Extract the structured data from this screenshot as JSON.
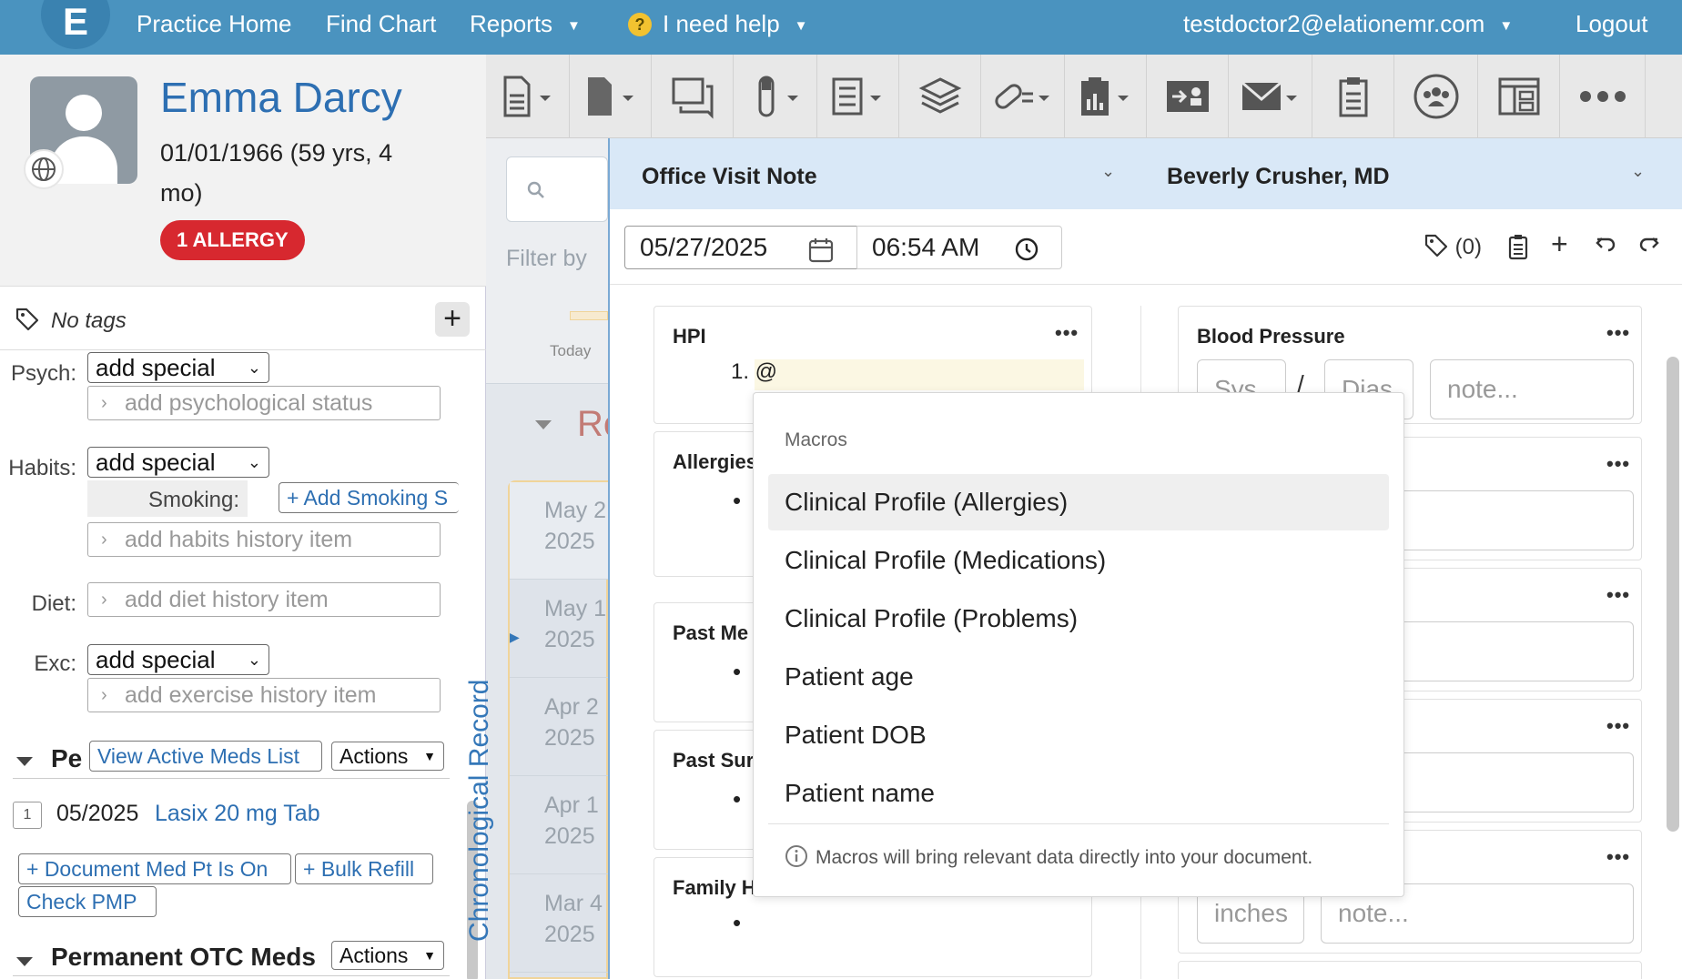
{
  "topnav": {
    "logo_glyph": "E",
    "practice_home": "Practice Home",
    "find_chart": "Find Chart",
    "reports": "Reports",
    "help_badge": "?",
    "help": "I need help",
    "user_email": "testdoctor2@elationemr.com",
    "logout": "Logout"
  },
  "patient": {
    "name": "Emma Darcy",
    "dob": "01/01/1966 (59 yrs, 4 mo)",
    "allergy_badge": "1 ALLERGY"
  },
  "tags": {
    "label": "No tags",
    "add": "+"
  },
  "history": {
    "psych_label": "Psych:",
    "psych_select": "add special",
    "psych_field": "add psychological status",
    "habits_label": "Habits:",
    "habits_select": "add special",
    "smoking_label": "Smoking:",
    "smoking_button": "+ Add Smoking S",
    "habits_field": "add habits history item",
    "diet_label": "Diet:",
    "diet_field": "add diet history item",
    "exc_label": "Exc:",
    "exc_select": "add special",
    "exc_field": "add exercise history item"
  },
  "meds": {
    "section_title": "Pe",
    "view_active": "View Active Meds List",
    "actions": "Actions",
    "row_qty": "1",
    "row_date": "05/2025",
    "row_med": "Lasix 20 mg Tab",
    "document_med": "+ Document Med Pt Is On",
    "bulk_refill": "+ Bulk Refill",
    "check_pmp": "Check PMP",
    "otc_title": "Permanent OTC Meds",
    "otc_actions": "Actions"
  },
  "timeline": {
    "filter_by": "Filter by",
    "today": "Today",
    "re": "Re",
    "chrono_label": "Chronological Record",
    "entries": [
      {
        "date": "May 2",
        "year": "2025"
      },
      {
        "date": "May 1",
        "year": "2025"
      },
      {
        "date": "Apr 2",
        "year": "2025"
      },
      {
        "date": "Apr 1",
        "year": "2025"
      },
      {
        "date": "Mar 4",
        "year": "2025"
      }
    ]
  },
  "note": {
    "title": "Office Visit Note",
    "author": "Beverly Crusher, MD",
    "date": "05/27/2025",
    "time": "06:54 AM",
    "tag_count": "(0)",
    "plus": "+"
  },
  "cards_left": {
    "hpi": "HPI",
    "hpi_line": "1. @",
    "allergies": "Allergies",
    "past_med": "Past Me",
    "past_surg": "Past Sur",
    "family": "Family H",
    "bullet": "•",
    "dots": "•••"
  },
  "cards_right": {
    "bp": "Blood Pressure",
    "sys": "Sys",
    "slash": "/",
    "dias": "Dias",
    "note_ph": "note...",
    "dots": "•••",
    "partial": "..",
    "inches": "inches",
    "note2": "note..."
  },
  "macros": {
    "header": "Macros",
    "items": [
      "Clinical Profile (Allergies)",
      "Clinical Profile (Medications)",
      "Clinical Profile (Problems)",
      "Patient age",
      "Patient DOB",
      "Patient name"
    ],
    "footer": "Macros will bring relevant data directly into your document."
  }
}
